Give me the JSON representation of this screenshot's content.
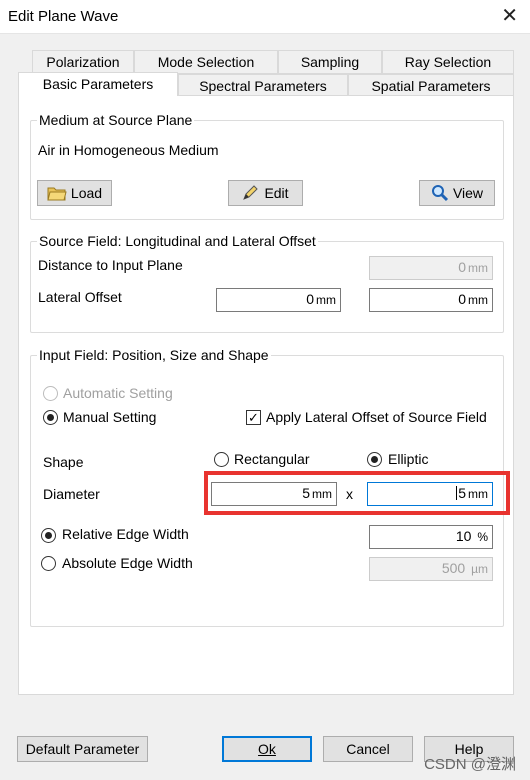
{
  "window": {
    "title": "Edit Plane Wave",
    "close_glyph": "✕"
  },
  "tabs_row1": [
    "Polarization",
    "Mode Selection",
    "Sampling",
    "Ray Selection"
  ],
  "tabs_row2": [
    "Basic Parameters",
    "Spectral Parameters",
    "Spatial Parameters"
  ],
  "medium": {
    "title": "Medium at Source Plane",
    "value": "Air in Homogeneous Medium",
    "load": "Load",
    "edit": "Edit",
    "view": "View"
  },
  "source_field": {
    "title": "Source Field: Longitudinal and Lateral Offset",
    "distance_label": "Distance to Input Plane",
    "distance_value": "0",
    "lateral_label": "Lateral Offset",
    "lateral_x": "0",
    "lateral_y": "0",
    "unit_mm": "mm"
  },
  "input_field": {
    "title": "Input Field: Position, Size and Shape",
    "automatic": "Automatic Setting",
    "manual": "Manual Setting",
    "apply_offset": "Apply Lateral Offset of Source Field",
    "shape_label": "Shape",
    "rectangular": "Rectangular",
    "elliptic": "Elliptic",
    "diameter_label": "Diameter",
    "diameter_x": "5",
    "diameter_y": "5",
    "times": "x",
    "unit_mm": "mm",
    "relative_edge": "Relative Edge Width",
    "relative_value": "10",
    "unit_percent": "%",
    "absolute_edge": "Absolute Edge Width",
    "absolute_value": "500",
    "unit_um": "µm"
  },
  "footer": {
    "default_param": "Default Parameter",
    "ok": "Ok",
    "cancel": "Cancel",
    "help": "Help"
  },
  "watermark": "CSDN @澄渊"
}
